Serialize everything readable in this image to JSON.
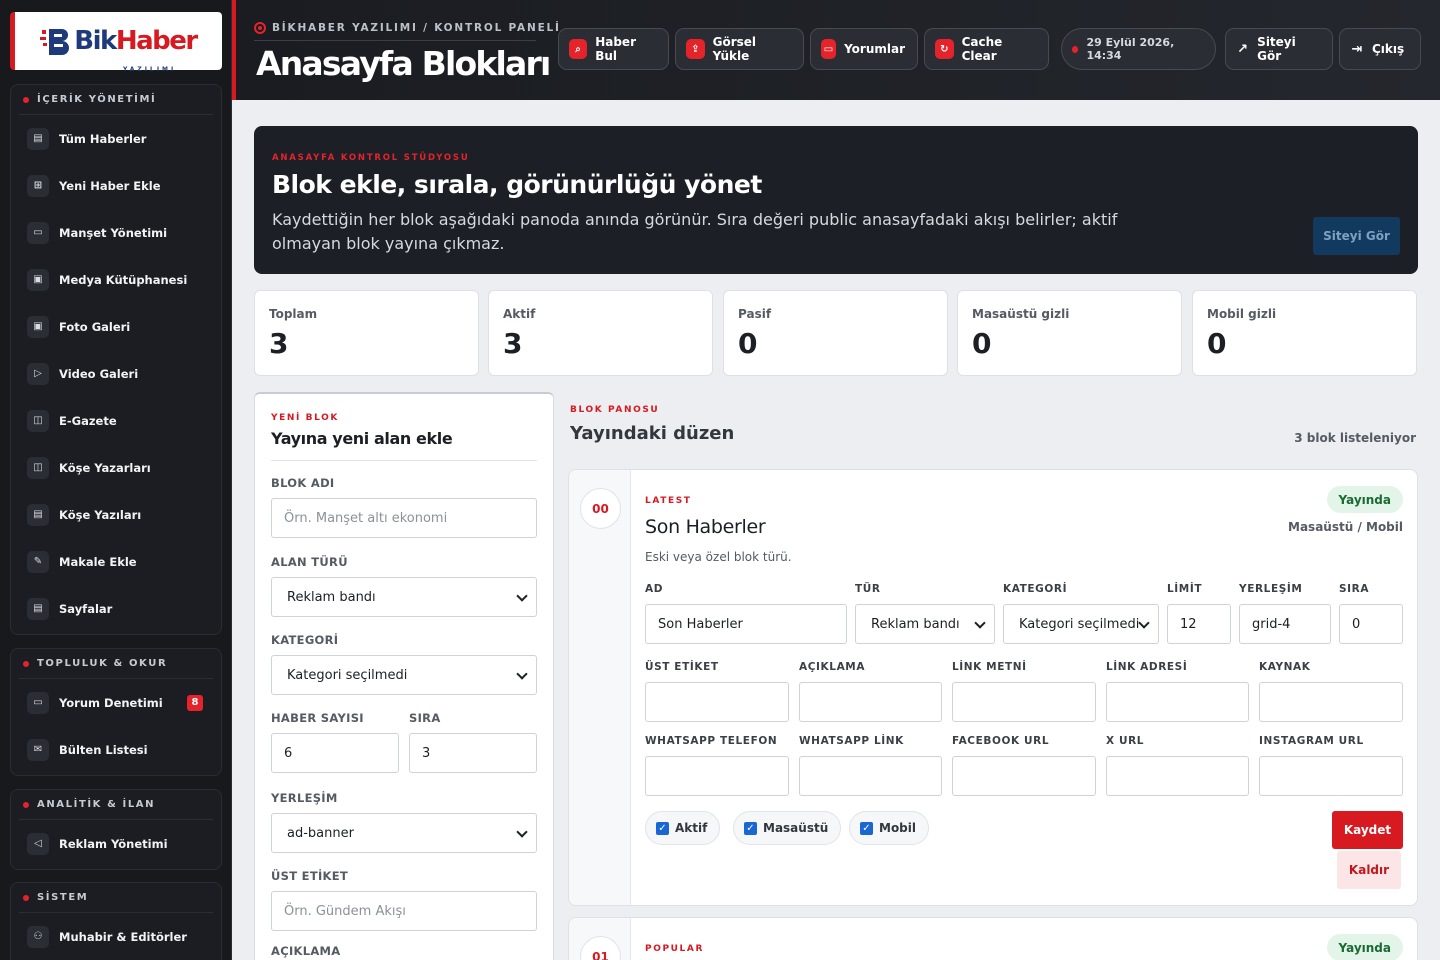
{
  "brand": {
    "name_part1": "Bik",
    "name_part2": "Haber",
    "subtitle": "YAZILIMI"
  },
  "sidebar": {
    "groups": [
      {
        "title": "İÇERİK YÖNETİMİ",
        "items": [
          {
            "label": "Tüm Haberler",
            "icon": "document-icon"
          },
          {
            "label": "Yeni Haber Ekle",
            "icon": "add-document-icon"
          },
          {
            "label": "Manşet Yönetimi",
            "icon": "banner-icon"
          },
          {
            "label": "Medya Kütüphanesi",
            "icon": "media-icon"
          },
          {
            "label": "Foto Galeri",
            "icon": "photo-icon"
          },
          {
            "label": "Video Galeri",
            "icon": "video-icon"
          },
          {
            "label": "E-Gazete",
            "icon": "book-icon"
          },
          {
            "label": "Köşe Yazarları",
            "icon": "book-icon"
          },
          {
            "label": "Köşe Yazıları",
            "icon": "document-icon"
          },
          {
            "label": "Makale Ekle",
            "icon": "edit-icon"
          },
          {
            "label": "Sayfalar",
            "icon": "document-icon"
          }
        ]
      },
      {
        "title": "TOPLULUK & OKUR",
        "items": [
          {
            "label": "Yorum Denetimi",
            "icon": "comment-icon",
            "badge": "8"
          },
          {
            "label": "Bülten Listesi",
            "icon": "mail-icon"
          }
        ]
      },
      {
        "title": "ANALİTİK & İLAN",
        "items": [
          {
            "label": "Reklam Yönetimi",
            "icon": "megaphone-icon"
          }
        ]
      },
      {
        "title": "SİSTEM",
        "items": [
          {
            "label": "Muhabir & Editörler",
            "icon": "users-icon"
          }
        ]
      }
    ]
  },
  "topbar": {
    "kicker": "BİKHABER YAZILIMI / KONTROL PANELİ",
    "title": "Anasayfa Blokları",
    "buttons": {
      "find_news": "Haber Bul",
      "upload_image": "Görsel Yükle",
      "comments": "Yorumlar",
      "cache_clear": "Cache Clear",
      "datetime": "29 Eylül 2026, 14:34",
      "view_site": "Siteyi Gör",
      "logout": "Çıkış"
    }
  },
  "hero": {
    "kicker": "ANASAYFA KONTROL STÜDYOSU",
    "title": "Blok ekle, sırala, görünürlüğü yönet",
    "description": "Kaydettiğin her blok aşağıdaki panoda anında görünür. Sıra değeri public anasayfadaki akışı belirler; aktif olmayan blok yayına çıkmaz.",
    "button": "Siteyi Gör"
  },
  "stats": [
    {
      "label": "Toplam",
      "value": "3"
    },
    {
      "label": "Aktif",
      "value": "3"
    },
    {
      "label": "Pasif",
      "value": "0"
    },
    {
      "label": "Masaüstü gizli",
      "value": "0"
    },
    {
      "label": "Mobil gizli",
      "value": "0"
    }
  ],
  "new_block": {
    "kicker": "YENİ BLOK",
    "title": "Yayına yeni alan ekle",
    "block_name_label": "BLOK ADI",
    "block_name_placeholder": "Örn. Manşet altı ekonomi",
    "area_type_label": "ALAN TÜRÜ",
    "area_type_value": "Reklam bandı",
    "category_label": "KATEGORİ",
    "category_value": "Kategori seçilmedi",
    "news_count_label": "HABER SAYISI",
    "news_count_value": "6",
    "order_label": "SIRA",
    "order_value": "3",
    "layout_label": "YERLEŞİM",
    "layout_value": "ad-banner",
    "top_tag_label": "ÜST ETİKET",
    "top_tag_placeholder": "Örn. Gündem Akışı",
    "description_label": "AÇIKLAMA"
  },
  "board": {
    "kicker": "BLOK PANOSU",
    "title": "Yayındaki düzen",
    "count_text": "3 blok listeleniyor",
    "blocks": [
      {
        "order": "00",
        "kicker": "LATEST",
        "name": "Son Haberler",
        "description": "Eski veya özel blok türü.",
        "status": "Yayında",
        "devices": "Masaüstü / Mobil",
        "labels": {
          "name": "AD",
          "type": "TÜR",
          "category": "KATEGORİ",
          "limit": "LİMİT",
          "layout": "YERLEŞİM",
          "order": "SIRA",
          "top_tag": "ÜST ETİKET",
          "description": "AÇIKLAMA",
          "link_text": "LİNK METNİ",
          "link_url": "LİNK ADRESİ",
          "source": "KAYNAK",
          "whatsapp_phone": "WHATSAPP TELEFON",
          "whatsapp_link": "WHATSAPP LİNK",
          "facebook": "FACEBOOK URL",
          "x": "X URL",
          "instagram": "INSTAGRAM URL"
        },
        "values": {
          "name": "Son Haberler",
          "type": "Reklam bandı",
          "category": "Kategori seçilmedi",
          "limit": "12",
          "layout": "grid-4",
          "order": "0"
        },
        "checks": {
          "active": "Aktif",
          "desktop": "Masaüstü",
          "mobile": "Mobil"
        },
        "save": "Kaydet",
        "remove": "Kaldır"
      },
      {
        "order": "01",
        "kicker": "POPULAR",
        "status": "Yayında"
      }
    ]
  }
}
